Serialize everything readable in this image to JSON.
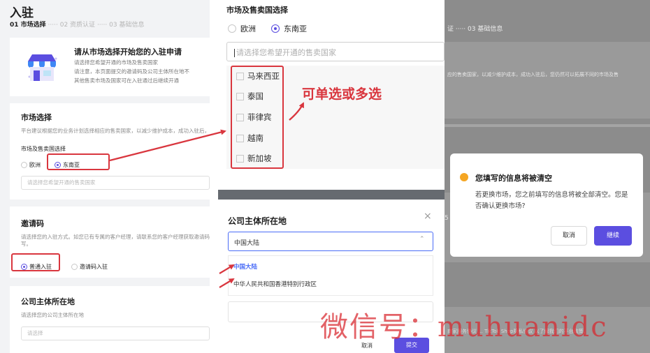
{
  "left": {
    "title": "入驻",
    "steps": [
      "01 市场选择",
      "·····",
      "02 资质认证",
      "·····",
      "03 基础信息"
    ],
    "intro": {
      "title": "请从市场选择开始您的入驻申请",
      "lines": [
        "请选择您希望开通的市场及售卖国家",
        "请注意，本页面提交的邀请码及公司主体所在地不",
        "其他售卖市场及国家可在入驻通过后继续开通"
      ]
    },
    "market": {
      "title": "市场选择",
      "desc": "平台建议根据您的业务计划选择相应的售卖国家，以减少维护成本，成功入驻后，",
      "field_label": "市场及售卖国选择",
      "options": [
        "欧洲",
        "东南亚"
      ],
      "placeholder": "请选择您希望开通的售卖国家"
    },
    "invite": {
      "title": "邀请码",
      "desc1": "请选择您的入驻方式。如您已有专属的客户经理，请联系您的客户经理获取邀请码",
      "desc2": "写。",
      "options": [
        "普通入驻",
        "邀请码入驻"
      ]
    },
    "company": {
      "title": "公司主体所在地",
      "desc": "请选择您的公司主体所在地",
      "placeholder": "请选择"
    }
  },
  "middle": {
    "title": "市场及售卖国选择",
    "options": [
      "欧洲",
      "东南亚"
    ],
    "placeholder": "请选择您希望开通的售卖国家",
    "countries": [
      "马来西亚",
      "泰国",
      "菲律宾",
      "越南",
      "新加坡"
    ],
    "annotation": "可单选或多选",
    "company_title": "公司主体所在地",
    "close": "×",
    "selected": "中国大陆",
    "arrow": "⌃",
    "dropdown": [
      "中国大陆",
      "中华人民共和国香港特别行政区"
    ],
    "cancel": "取消",
    "submit": "提交"
  },
  "right": {
    "steps": "证 ····· 03 基础信息",
    "desc": "应的售卖国家，以减少维护成本，成功入驻后，您仍然可以拓展不同的市场及售",
    "mark": "5",
    "dialog": {
      "title": "您填写的信息将被清空",
      "body": "若更换市场，您之前填写的信息将被全部清空。您是否确认更换市场?",
      "cancel": "取消",
      "confirm": "继续"
    },
    "footer": "商家服务协议 ... TikTok Shop隐私协议 以了解我们的平台政策。"
  },
  "watermark": "微信号：muhuanidc",
  "colors": {
    "accent": "#5b4ee0",
    "annotation": "#d9363e",
    "link": "#4a6cf7",
    "warning": "#f5a623"
  }
}
